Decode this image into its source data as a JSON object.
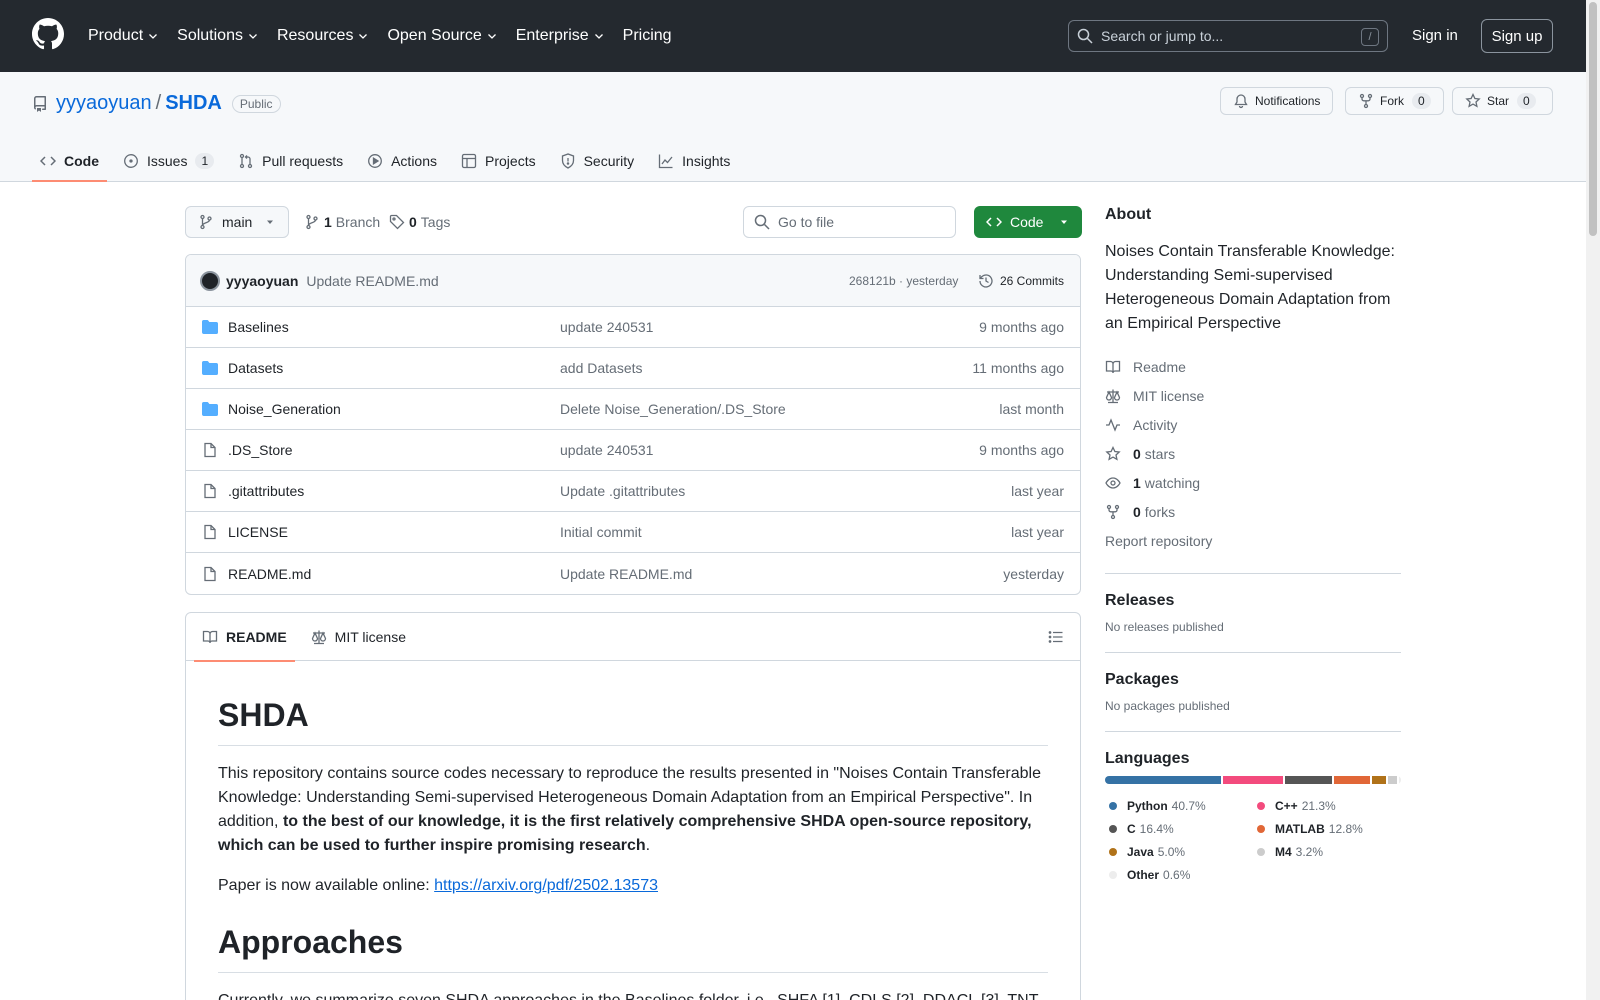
{
  "header": {
    "nav": [
      "Product",
      "Solutions",
      "Resources",
      "Open Source",
      "Enterprise",
      "Pricing"
    ],
    "search_placeholder": "Search or jump to...",
    "search_shortcut": "/",
    "signin": "Sign in",
    "signup": "Sign up"
  },
  "repo": {
    "owner": "yyyaoyuan",
    "separator": "/",
    "name": "SHDA",
    "visibility": "Public",
    "notifications": "Notifications",
    "fork_label": "Fork",
    "fork_count": "0",
    "star_label": "Star",
    "star_count": "0"
  },
  "tabs": [
    {
      "label": "Code",
      "icon": "code-icon",
      "active": true
    },
    {
      "label": "Issues",
      "icon": "issue-icon",
      "count": "1"
    },
    {
      "label": "Pull requests",
      "icon": "pull-request-icon"
    },
    {
      "label": "Actions",
      "icon": "play-icon"
    },
    {
      "label": "Projects",
      "icon": "table-icon"
    },
    {
      "label": "Security",
      "icon": "shield-icon"
    },
    {
      "label": "Insights",
      "icon": "graph-icon"
    }
  ],
  "toolbar": {
    "branch": "main",
    "branch_count": "1",
    "branch_label": "Branch",
    "tag_count": "0",
    "tag_label": "Tags",
    "goto_placeholder": "Go to file",
    "code_button": "Code"
  },
  "commit": {
    "author": "yyyaoyuan",
    "message": "Update README.md",
    "sha_time": "268121b · yesterday",
    "commits": "26 Commits"
  },
  "files": [
    {
      "name": "Baselines",
      "type": "folder",
      "message": "update 240531",
      "date": "9 months ago"
    },
    {
      "name": "Datasets",
      "type": "folder",
      "message": "add Datasets",
      "date": "11 months ago"
    },
    {
      "name": "Noise_Generation",
      "type": "folder",
      "message": "Delete Noise_Generation/.DS_Store",
      "date": "last month"
    },
    {
      "name": ".DS_Store",
      "type": "file",
      "message": "update 240531",
      "date": "9 months ago"
    },
    {
      "name": ".gitattributes",
      "type": "file",
      "message": "Update .gitattributes",
      "date": "last year"
    },
    {
      "name": "LICENSE",
      "type": "file",
      "message": "Initial commit",
      "date": "last year"
    },
    {
      "name": "README.md",
      "type": "file",
      "message": "Update README.md",
      "date": "yesterday"
    }
  ],
  "readme": {
    "tab_readme": "README",
    "tab_license": "MIT license",
    "title": "SHDA",
    "para1_start": "This repository contains source codes necessary to reproduce the results presented in \"Noises Contain Transferable Knowledge: Understanding Semi-supervised Heterogeneous Domain Adaptation from an Empirical Perspective\". In addition, ",
    "para1_bold": "to the best of our knowledge, it is the first relatively comprehensive SHDA open-source repository, which can be used to further inspire promising research",
    "para1_end": ".",
    "para2_start": "Paper is now available online: ",
    "para2_link": "https://arxiv.org/pdf/2502.13573",
    "heading2": "Approaches",
    "para3": "Currently, we summarize seven SHDA approaches in the Baselines folder, i.e., SHFA [1], CDLS [2], DDACL [3], TNT"
  },
  "about": {
    "title": "About",
    "description": "Noises Contain Transferable Knowledge: Understanding Semi-supervised Heterogeneous Domain Adaptation from an Empirical Perspective",
    "readme": "Readme",
    "license": "MIT license",
    "activity": "Activity",
    "stars_count": "0",
    "stars_label": "stars",
    "watching_count": "1",
    "watching_label": "watching",
    "forks_count": "0",
    "forks_label": "forks",
    "report": "Report repository"
  },
  "releases": {
    "title": "Releases",
    "text": "No releases published"
  },
  "packages": {
    "title": "Packages",
    "text": "No packages published"
  },
  "languages": {
    "title": "Languages",
    "items": [
      {
        "name": "Python",
        "pct": "40.7%",
        "value": 40.7,
        "color": "#3572A5"
      },
      {
        "name": "C++",
        "pct": "21.3%",
        "value": 21.3,
        "color": "#f34b7d"
      },
      {
        "name": "C",
        "pct": "16.4%",
        "value": 16.4,
        "color": "#555555"
      },
      {
        "name": "MATLAB",
        "pct": "12.8%",
        "value": 12.8,
        "color": "#e16737"
      },
      {
        "name": "Java",
        "pct": "5.0%",
        "value": 5.0,
        "color": "#b07219"
      },
      {
        "name": "M4",
        "pct": "3.2%",
        "value": 3.2,
        "color": "#cccccc"
      },
      {
        "name": "Other",
        "pct": "0.6%",
        "value": 0.6,
        "color": "#ededed"
      }
    ]
  }
}
